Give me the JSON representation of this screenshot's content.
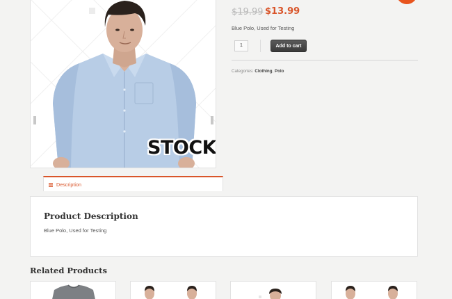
{
  "product": {
    "image_watermark": "STOCK",
    "price_old": "$19.99",
    "price_new": "$13.99",
    "short_description": "Blue Polo, Used for Testing",
    "quantity": "1",
    "add_to_cart_label": "Add to cart",
    "categories_label": "Categories:",
    "categories": [
      "Clothing",
      "Polo"
    ]
  },
  "tabs": [
    {
      "label": "Description",
      "icon": "list-icon",
      "active": true
    }
  ],
  "description_panel": {
    "title": "Product Description",
    "body": "Blue Polo, Used for Testing"
  },
  "related": {
    "title": "Related Products",
    "items": [
      {
        "thumbnail": "grey-tshirt"
      },
      {
        "thumbnail": "two-men"
      },
      {
        "thumbnail": "man-head"
      },
      {
        "thumbnail": "two-men"
      }
    ]
  },
  "colors": {
    "accent": "#d9552a",
    "badge": "#e8541e",
    "button": "#444444",
    "background": "#f3f3f2"
  }
}
